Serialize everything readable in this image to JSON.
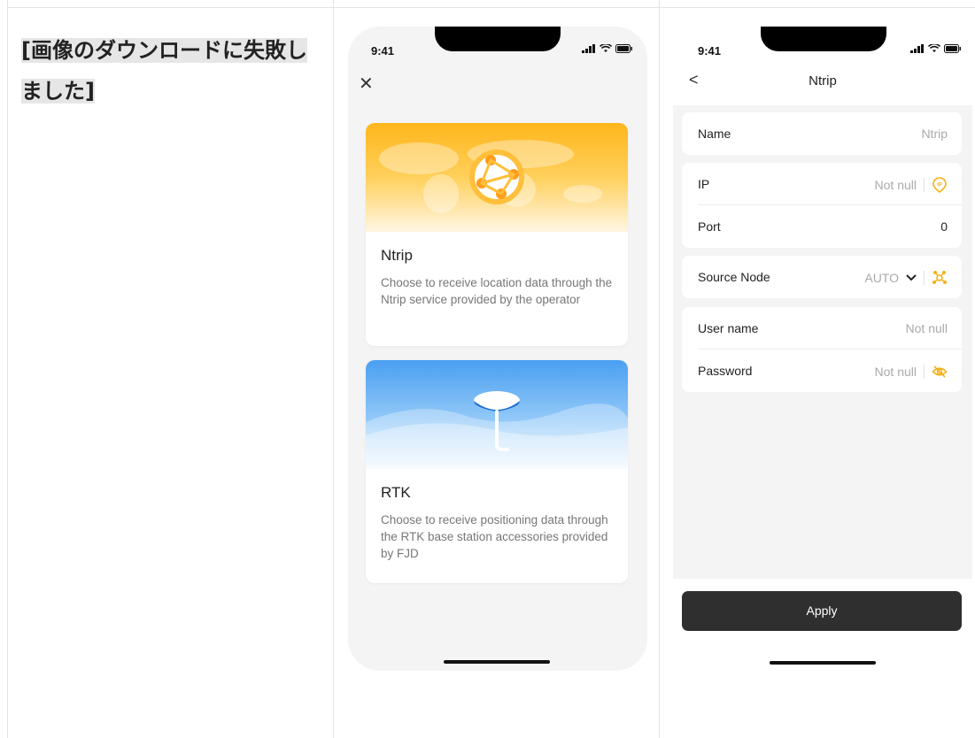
{
  "failed_download": {
    "text": "[画像のダウンロードに失敗しました]"
  },
  "screen_select": {
    "time": "9:41",
    "cards": [
      {
        "title": "Ntrip",
        "description": "Choose to receive location data through the Ntrip service provided by the operator"
      },
      {
        "title": "RTK",
        "description": "Choose to receive positioning data through the RTK base station accessories provided by FJD"
      }
    ]
  },
  "screen_ntrip": {
    "time": "9:41",
    "title": "Ntrip",
    "fields": {
      "name": {
        "label": "Name",
        "value": "Ntrip"
      },
      "ip": {
        "label": "IP",
        "value": "Not null"
      },
      "port": {
        "label": "Port",
        "value": "0"
      },
      "source_node": {
        "label": "Source Node",
        "value": "AUTO"
      },
      "username": {
        "label": "User name",
        "value": "Not null"
      },
      "password": {
        "label": "Password",
        "value": "Not null"
      }
    },
    "apply_label": "Apply"
  },
  "colors": {
    "accent": "#F5B21B",
    "button": "#2F2F2F",
    "background": "#F4F4F4"
  }
}
